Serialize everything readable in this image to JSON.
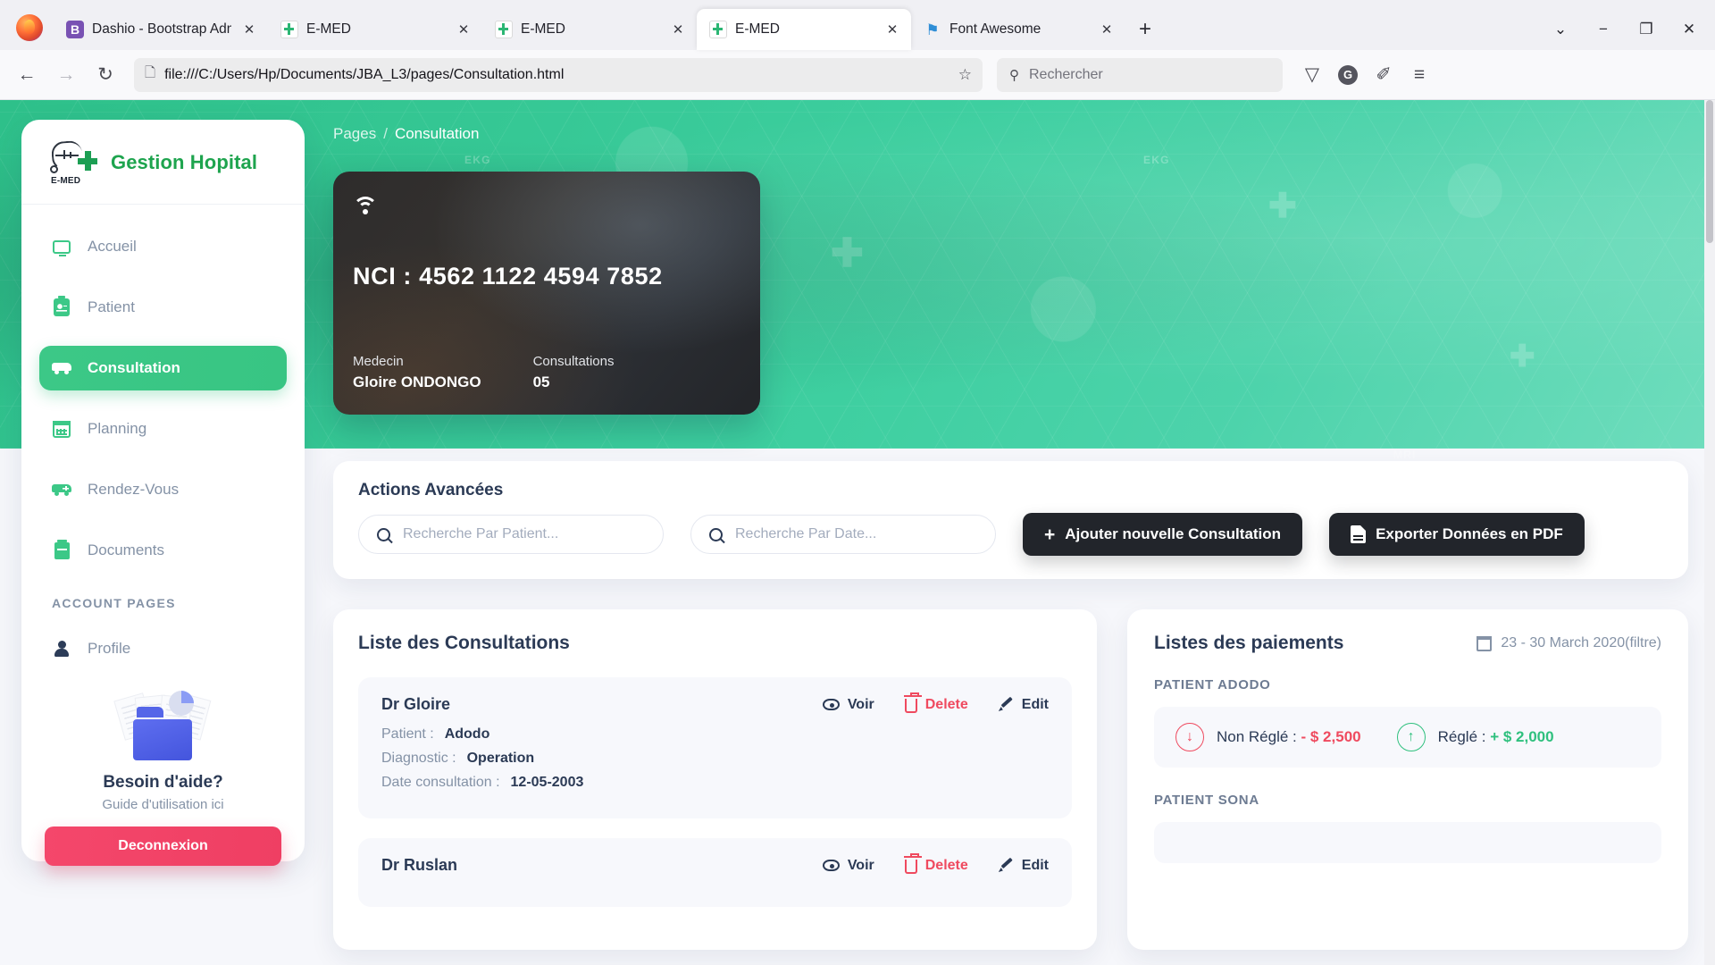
{
  "browser": {
    "tabs": [
      {
        "title": "Dashio - Bootstrap Admin Temp",
        "favicon": "bootstrap-icon",
        "active": false
      },
      {
        "title": "E-MED",
        "favicon": "emed-icon",
        "active": false
      },
      {
        "title": "E-MED",
        "favicon": "emed-icon",
        "active": false
      },
      {
        "title": "E-MED",
        "favicon": "emed-icon",
        "active": true
      },
      {
        "title": "Font Awesome",
        "favicon": "font-awesome-icon",
        "active": false
      }
    ],
    "new_tab_label": "+",
    "tab_list_chevron": "⌄",
    "window_minimize": "−",
    "window_maximize": "❐",
    "window_close": "✕",
    "close_glyph": "✕",
    "back_glyph": "←",
    "forward_glyph": "→",
    "reload_glyph": "↻",
    "url": "file:///C:/Users/Hp/Documents/JBA_L3/pages/Consultation.html",
    "doc_glyph": "🗋",
    "star_glyph": "☆",
    "search_placeholder": "Rechercher",
    "search_glyph": "⚲",
    "pocket_glyph": "▽",
    "account_glyph": "G",
    "extensions_glyph": "✐",
    "menu_glyph": "≡"
  },
  "sidebar": {
    "brand_name": "Gestion Hopital",
    "brand_logo_text": "E-MED",
    "items": [
      {
        "label": "Accueil",
        "icon": "monitor-icon",
        "active": false
      },
      {
        "label": "Patient",
        "icon": "id-badge-icon",
        "active": false
      },
      {
        "label": "Consultation",
        "icon": "ambulance-icon",
        "active": true
      },
      {
        "label": "Planning",
        "icon": "calendar-icon",
        "active": false
      },
      {
        "label": "Rendez-Vous",
        "icon": "ambulance-icon",
        "active": false
      },
      {
        "label": "Documents",
        "icon": "document-box-icon",
        "active": false
      }
    ],
    "section_label": "ACCOUNT PAGES",
    "account_items": [
      {
        "label": "Profile",
        "icon": "person-icon",
        "active": false
      }
    ],
    "help": {
      "title": "Besoin d'aide?",
      "subtitle": "Guide d'utilisation ici",
      "logout_label": "Deconnexion"
    }
  },
  "breadcrumb": {
    "parent": "Pages",
    "separator": "/",
    "current": "Consultation"
  },
  "nci_card": {
    "wifi_icon": "wifi-icon",
    "nci_number": "NCI : 4562  1122  4594  7852",
    "fields": [
      {
        "label": "Medecin",
        "value": "Gloire ONDONGO"
      },
      {
        "label": "Consultations",
        "value": "05"
      }
    ]
  },
  "actions": {
    "title": "Actions Avancées",
    "search_patient_placeholder": "Recherche Par Patient...",
    "search_date_placeholder": "Recherche Par Date...",
    "add_button": "Ajouter nouvelle Consultation",
    "add_button_glyph": "+",
    "export_button": "Exporter Données en PDF"
  },
  "consultations": {
    "title": "Liste des Consultations",
    "action_labels": {
      "view": "Voir",
      "delete": "Delete",
      "edit": "Edit"
    },
    "items": [
      {
        "doctor": "Dr Gloire",
        "fields": [
          {
            "label": "Patient :",
            "value": "Adodo"
          },
          {
            "label": "Diagnostic :",
            "value": "Operation"
          },
          {
            "label": "Date consultation :",
            "value": "12-05-2003"
          }
        ]
      },
      {
        "doctor": "Dr Ruslan",
        "fields": []
      }
    ]
  },
  "payments": {
    "title": "Listes des paiements",
    "date_range": "23 - 30 March 2020(filtre)",
    "calendar_icon": "calendar-icon",
    "groups": [
      {
        "patient_label": "PATIENT ADODO",
        "rows": [
          {
            "icon": "arrow-down-circle-icon",
            "direction": "down",
            "label": "Non Réglé : ",
            "amount": "- $ 2,500"
          },
          {
            "icon": "arrow-up-circle-icon",
            "direction": "up",
            "label": "Réglé : ",
            "amount": "+ $ 2,000"
          }
        ]
      },
      {
        "patient_label": "PATIENT SONA",
        "rows": []
      }
    ]
  },
  "colors": {
    "brand_green": "#1ea44e",
    "accent_green": "#3cc887",
    "danger_red": "#ef4a5f",
    "logout_red": "#ef3f63",
    "dark_button": "#22252b",
    "text_dark": "#2b3a55",
    "text_muted": "#8492a6"
  }
}
